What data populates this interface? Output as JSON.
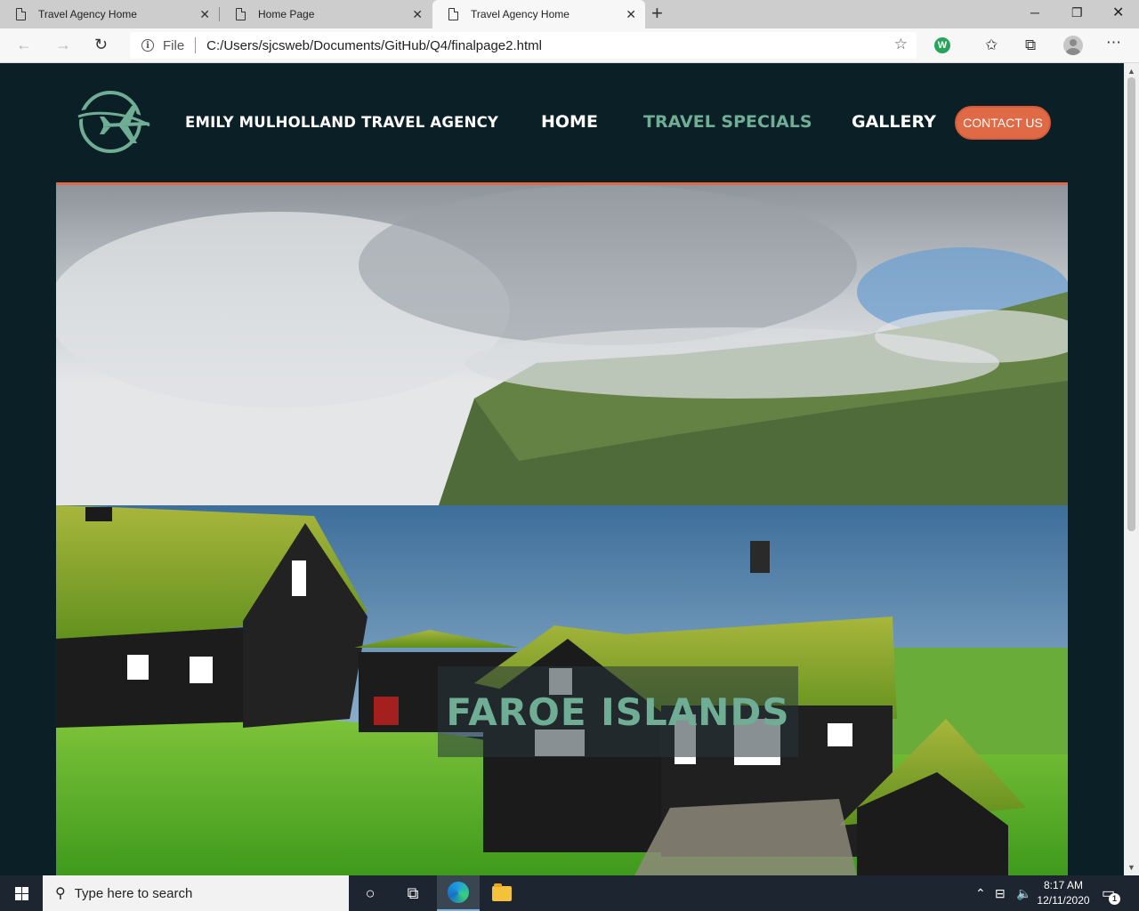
{
  "browser": {
    "tabs": [
      {
        "title": "Travel Agency Home",
        "active": false
      },
      {
        "title": "Home Page",
        "active": false
      },
      {
        "title": "Travel Agency Home",
        "active": true
      }
    ],
    "address": {
      "scheme_label": "File",
      "url": "C:/Users/sjcsweb/Documents/GitHub/Q4/finalpage2.html"
    },
    "extension_letter": "W"
  },
  "site": {
    "brand": "EMILY MULHOLLAND TRAVEL AGENCY",
    "nav": [
      {
        "label": "HOME",
        "current": false
      },
      {
        "label": "TRAVEL SPECIALS",
        "current": true
      },
      {
        "label": "GALLERY",
        "current": false
      }
    ],
    "contact_label": "CONTACT US",
    "hero_caption": "FAROE ISLANDS",
    "colors": {
      "background": "#0b1f26",
      "accent_green": "#6fae94",
      "accent_orange": "#e06a45"
    }
  },
  "taskbar": {
    "search_placeholder": "Type here to search",
    "time": "8:17 AM",
    "date": "12/11/2020",
    "notification_count": "1"
  }
}
